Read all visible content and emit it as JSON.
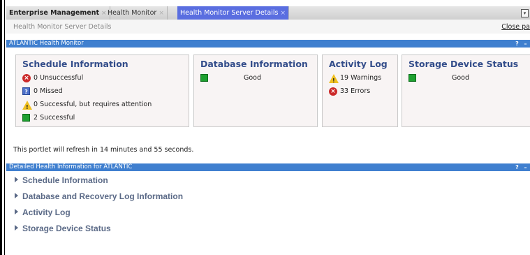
{
  "tabs": [
    {
      "label": "Enterprise Management",
      "close": "×"
    },
    {
      "label": "Health Monitor",
      "close": "×"
    },
    {
      "label": "Health Monitor Server Details",
      "close": "×"
    }
  ],
  "subheader": {
    "title": "Health Monitor Server Details",
    "close_label": "Close pa"
  },
  "portlet1": {
    "title": "ATLANTIC Health Monitor",
    "help": "?",
    "minimize": "–",
    "refresh_text": "This portlet will refresh in 14 minutes and 55 seconds."
  },
  "schedule": {
    "title": "Schedule Information",
    "items": [
      {
        "icon": "error-icon",
        "text": "0 Unsuccessful"
      },
      {
        "icon": "question-icon",
        "text": "0 Missed"
      },
      {
        "icon": "warning-icon",
        "text": "0 Successful, but requires attention"
      },
      {
        "icon": "success-icon",
        "text": "2 Successful"
      }
    ]
  },
  "database": {
    "title": "Database Information",
    "status": "Good"
  },
  "activity": {
    "title": "Activity Log",
    "warnings": "19 Warnings",
    "errors": "33 Errors"
  },
  "storage": {
    "title": "Storage Device Status",
    "status": "Good"
  },
  "portlet2": {
    "title": "Detailed Health Information for ATLANTIC",
    "help": "?",
    "minimize": "–",
    "sections": [
      "Schedule Information",
      "Database and Recovery Log Information",
      "Activity Log",
      "Storage Device Status"
    ]
  },
  "colors": {
    "header_blue": "#3f7fcf",
    "active_tab": "#5a6ee0",
    "title_blue": "#334d8a",
    "error_red": "#cc2a2a",
    "success_green": "#1ea030",
    "warning_yellow": "#f0c020"
  }
}
